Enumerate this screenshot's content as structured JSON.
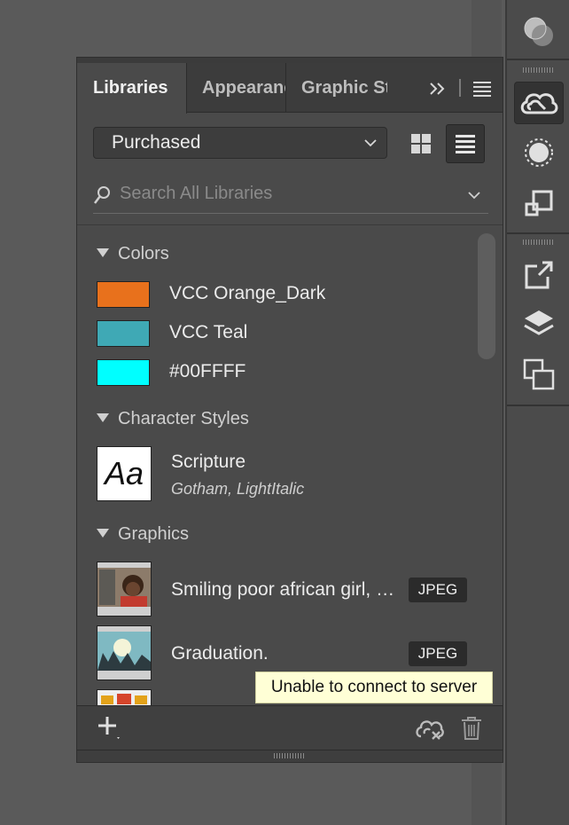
{
  "tabs": [
    {
      "label": "Libraries"
    },
    {
      "label": "Appearance"
    },
    {
      "label": "Graphic Styles"
    }
  ],
  "library_select": {
    "value": "Purchased"
  },
  "search": {
    "placeholder": "Search All Libraries"
  },
  "sections": {
    "colors": {
      "title": "Colors",
      "items": [
        {
          "label": "VCC Orange_Dark",
          "color": "#E8711C"
        },
        {
          "label": "VCC Teal",
          "color": "#3FA9B5"
        },
        {
          "label": "#00FFFF",
          "color": "#00FFFF"
        }
      ]
    },
    "character_styles": {
      "title": "Character Styles",
      "items": [
        {
          "preview": "Aa",
          "label": "Scripture",
          "sub": "Gotham, LightItalic"
        }
      ]
    },
    "graphics": {
      "title": "Graphics",
      "items": [
        {
          "label": "Smiling poor african girl, …",
          "badge": "JPEG"
        },
        {
          "label": "Graduation.",
          "badge": "JPEG"
        }
      ]
    }
  },
  "tooltip": {
    "text": "Unable to connect to server"
  },
  "icons": [
    "color-theme-icon",
    "creative-cloud-libraries-icon",
    "circle-dotted-icon",
    "transform-icon",
    "export-icon",
    "layers-icon",
    "artboards-icon",
    "collapse-chevrons-icon",
    "panel-menu-icon",
    "grid-view-icon",
    "list-view-icon",
    "search-icon",
    "chevron-down-icon",
    "add-icon",
    "cloud-disconnected-icon",
    "trash-icon"
  ]
}
